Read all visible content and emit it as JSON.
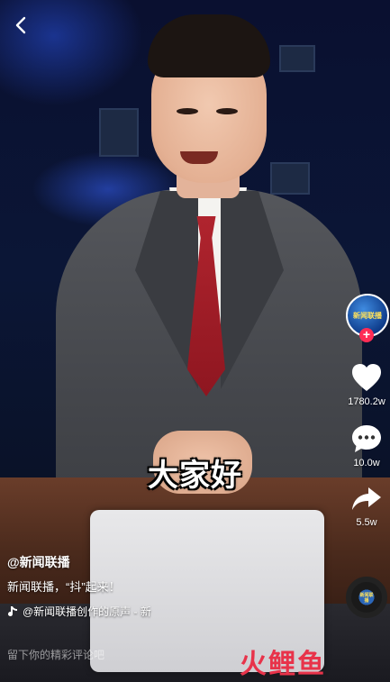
{
  "nav": {
    "back_icon": "chevron-left-icon"
  },
  "video": {
    "subtitle": "大家好"
  },
  "profile": {
    "avatar_text": "新闻联播",
    "follow_symbol": "+"
  },
  "actions": {
    "likes": "1780.2w",
    "comments": "10.0w",
    "shares": "5.5w"
  },
  "post": {
    "author": "@新闻联播",
    "caption": "新闻联播，“抖”起来！",
    "music": "@新闻联播创作的原声 - 新"
  },
  "comment_placeholder": "留下你的精彩评论吧",
  "watermark": {
    "part1": "火",
    "part2": "鲤",
    "part3": "鱼"
  },
  "colors": {
    "accent": "#fe2c55",
    "watermark": "#e8334a"
  }
}
